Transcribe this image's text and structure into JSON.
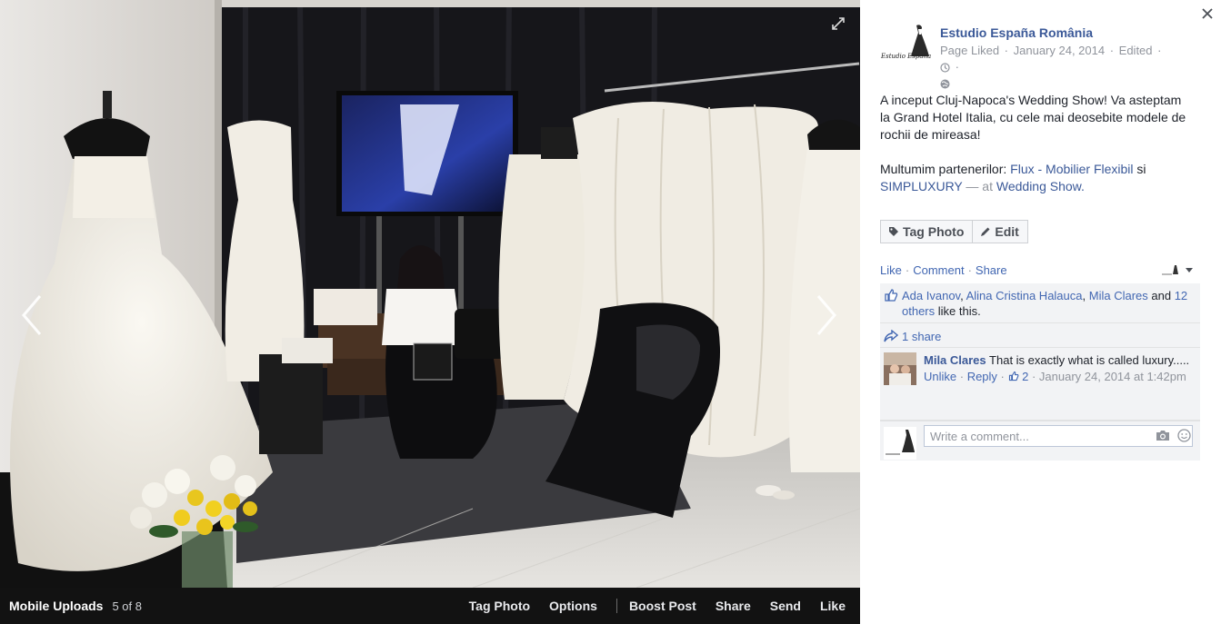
{
  "photo_bar": {
    "album": "Mobile Uploads",
    "count": "5 of 8",
    "actions": [
      "Tag Photo",
      "Options",
      "Boost Post",
      "Share",
      "Send",
      "Like"
    ]
  },
  "post": {
    "page_name": "Estudio España România",
    "avatar_text": "Estudio España",
    "status": "Page Liked",
    "date": "January 24, 2014",
    "edited": "Edited",
    "text_line1": "A inceput Cluj-Napoca's Wedding Show! Va asteptam la Grand Hotel Italia, cu cele mai deosebite modele de rochii de mireasa!",
    "thanks_prefix": "Multumim partenerilor: ",
    "partner1": "Flux - Mobilier Flexibil",
    "thanks_and": " si ",
    "partner2": "SIMPLUXURY",
    "at_text": " — at ",
    "location": "Wedding Show",
    "location_suffix": "."
  },
  "buttons": {
    "tag_photo": "Tag Photo",
    "edit": "Edit"
  },
  "actions": {
    "like": "Like",
    "comment": "Comment",
    "share": "Share"
  },
  "likes": {
    "names": [
      "Ada Ivanov",
      "Alina Cristina Halauca",
      "Mila Clares"
    ],
    "sep1": ", ",
    "sep2": ", ",
    "and": " and ",
    "others": "12 others",
    "suffix": " like this."
  },
  "shares": {
    "label": "1 share"
  },
  "comment": {
    "author": "Mila Clares",
    "text": "That is exactly what is called luxury.....",
    "unlike": "Unlike",
    "reply": "Reply",
    "like_count": "2",
    "timestamp": "January 24, 2014 at 1:42pm"
  },
  "composer": {
    "placeholder": "Write a comment..."
  },
  "colors": {
    "link": "#3b5998",
    "action_link": "#4267b2",
    "meta": "#90949c",
    "ufi_bg": "#f2f3f5"
  }
}
